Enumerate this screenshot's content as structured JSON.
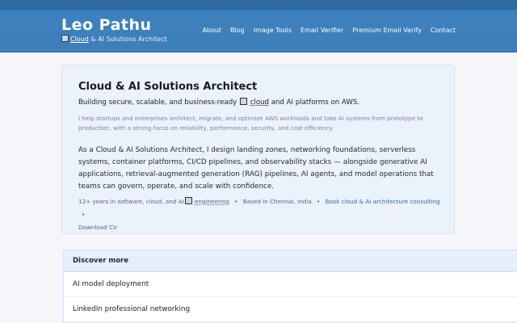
{
  "header": {
    "site_title": "Leo Pathu",
    "tagline_link": "Cloud",
    "tagline_rest": "& AI Solutions Architect"
  },
  "nav": {
    "items": [
      "About",
      "Blog",
      "Image Tools",
      "Email Verifier",
      "Premium Email Verify",
      "Contact"
    ]
  },
  "card": {
    "title": "Cloud & AI Solutions Architect",
    "subtitle_part1": "Building secure, scalable, and business-ready",
    "subtitle_link": "cloud",
    "subtitle_part2": "and AI platforms on AWS.",
    "intro": "I help startups and enterprises architect, migrate, and optimize AWS workloads and take AI systems from prototype to production, with a strong focus on reliability, performance, security, and cost efficiency.",
    "body": "As a Cloud & AI Solutions Architect, I design landing zones, networking foundations, serverless systems, container platforms, CI/CD pipelines, and observability stacks — alongside generative AI applications, retrieval-augmented generation (RAG) pipelines, AI agents, and model operations that teams can govern, operate, and scale with confidence.",
    "meta_experience_prefix": "12+ years in software, cloud, and AI",
    "meta_experience_link": "engineering",
    "meta_location": "Based in Chennai, India",
    "meta_consulting": "Book cloud & AI architecture consulting",
    "meta_cv": "Download CV",
    "separator": "•"
  },
  "discover": {
    "header": "Discover more",
    "items": [
      "AI model deployment",
      "LinkedIn professional networking"
    ]
  },
  "colors": {
    "header_bg": "#3d80bd",
    "card_bg": "#eaf2fc",
    "link": "#2e6aa8"
  }
}
